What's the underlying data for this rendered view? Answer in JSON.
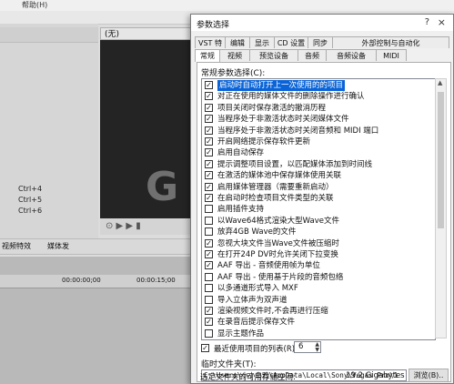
{
  "background": {
    "menu_help": "帮助(H)",
    "preview_title": "(无)",
    "shortcuts": [
      "Ctrl+4",
      "Ctrl+5",
      "Ctrl+6"
    ],
    "tabs": [
      "视频特效",
      "媒体发"
    ],
    "ruler": [
      "00:00:00;00",
      "00:00:15;00"
    ],
    "watermark": "G"
  },
  "dialog": {
    "title": "参数选择",
    "help_label": "?",
    "close_label": "×",
    "tabs_row1": [
      "VST 特效",
      "编辑",
      "显示",
      "CD 设置",
      "同步",
      "外部控制与自动化"
    ],
    "tabs_row2": [
      "常规",
      "视频",
      "预览设备",
      "音频",
      "音频设备",
      "MIDI"
    ],
    "active_tab": "常规",
    "group_label": "常规参数选择(C):",
    "options": [
      {
        "label": "启动时自动打开上一次使用的的项目",
        "checked": true,
        "selected": true
      },
      {
        "label": "对正在使用的媒体文件的删除操作进行确认",
        "checked": true
      },
      {
        "label": "项目关闭时保存激活的撤消历程",
        "checked": true
      },
      {
        "label": "当程序处于非激活状态时关闭媒体文件",
        "checked": true
      },
      {
        "label": "当程序处于非激活状态时关闭音频和 MIDI 端口",
        "checked": true
      },
      {
        "label": "开启网络提示保存软件更新",
        "checked": true
      },
      {
        "label": "启用自动保存",
        "checked": true
      },
      {
        "label": "提示调整项目设置，以匹配媒体添加到时间线",
        "checked": true
      },
      {
        "label": "在激活的媒体池中保存媒体使用关联",
        "checked": true
      },
      {
        "label": "启用媒体管理器（需要重新启动）",
        "checked": true
      },
      {
        "label": "在启动时检查项目文件类型的关联",
        "checked": true
      },
      {
        "label": "启用插件支持",
        "checked": false
      },
      {
        "label": "以Wave64格式渲染大型Wave文件",
        "checked": false
      },
      {
        "label": "放弃4GB Wave的文件",
        "checked": false
      },
      {
        "label": "忽视大块文件当Wave文件被压缩时",
        "checked": true
      },
      {
        "label": "在打开24P DV时允许关闭下拉变换",
        "checked": true
      },
      {
        "label": "AAF 导出 - 音频使用帧为单位",
        "checked": true
      },
      {
        "label": "AAF 导出 - 使用基于片段的音频包络",
        "checked": false
      },
      {
        "label": "以多通道形式导入 MXF",
        "checked": false
      },
      {
        "label": "导入立体声为双声道",
        "checked": false
      },
      {
        "label": "渲染视频文件时,不会再进行压缩",
        "checked": true
      },
      {
        "label": "在录音后提示保存文件",
        "checked": true
      },
      {
        "label": "显示主题作品",
        "checked": false
      }
    ],
    "recent_label": "最近使用项目的列表(R)",
    "recent_checked": true,
    "recent_value": "6",
    "temp_label": "临时文件夹(T):",
    "temp_value": "C:\\Users\\小小鸟鸦\\AppData\\Local\\Sony\\Vegas Pro\\1",
    "browse_label": "浏览(B)..",
    "space_label": "选定文件夹的可用存储空间:",
    "space_value": "19.2 Gigabytes"
  }
}
